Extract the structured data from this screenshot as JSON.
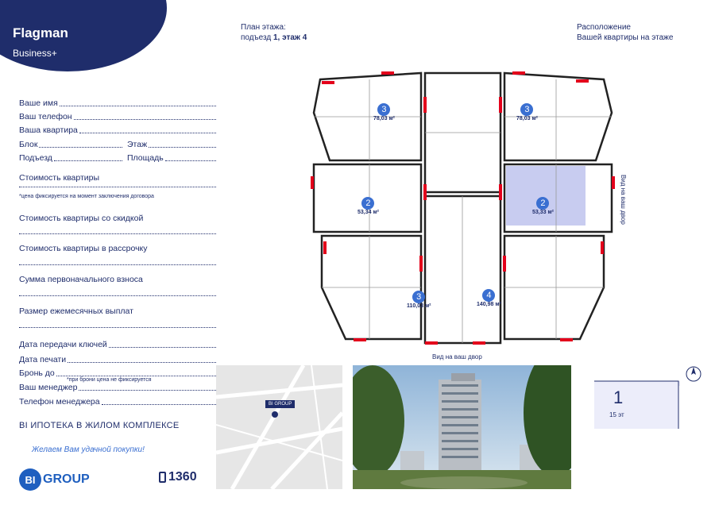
{
  "brand": {
    "title": "Flagman",
    "subtitle": "Business+"
  },
  "form": {
    "name": "Ваше имя",
    "phone": "Ваш телефон",
    "apartment": "Ваша квартира",
    "block": "Блок",
    "floor": "Этаж",
    "entrance": "Подъезд",
    "area": "Площадь",
    "price": "Стоимость квартиры",
    "price_note": "*цена фиксируется на момент заключения договора",
    "price_discount": "Стоимость квартиры со скидкой",
    "price_installment": "Стоимость квартиры в рассрочку",
    "down_payment": "Сумма первоначального взноса",
    "monthly": "Размер ежемесячных выплат",
    "keys_date": "Дата передачи ключей",
    "print_date": "Дата печати",
    "booking": "Бронь до",
    "booking_note": "*при брони цена не фиксируется",
    "manager": "Ваш менеджер",
    "manager_phone": "Телефон менеджера"
  },
  "footer": {
    "mortgage": "BI ИПОТЕКА В ЖИЛОМ КОМПЛЕКСЕ",
    "wish": "Желаем Вам удачной покупки!",
    "logo_mark": "BI",
    "logo_text": "GROUP",
    "short_number": "1360"
  },
  "plan": {
    "heading_line1": "План этажа:",
    "heading_line2_prefix": "подъезд ",
    "heading_line2_value": "1, этаж 4",
    "location_line1": "Расположение",
    "location_line2": "Вашей квартиры на этаже",
    "view_right": "Вид на ваш двор",
    "view_bottom": "Вид на ваш двор",
    "units": [
      {
        "rooms": "3",
        "area": "78,03 м²"
      },
      {
        "rooms": "3",
        "area": "78,03 м²"
      },
      {
        "rooms": "2",
        "area": "53,34 м²"
      },
      {
        "rooms": "2",
        "area": "53,33 м²"
      },
      {
        "rooms": "3",
        "area": "110,03 м²"
      },
      {
        "rooms": "4",
        "area": "140,98 м²"
      }
    ]
  },
  "map": {
    "marker": "BI GROUP"
  },
  "building": {
    "floor": "1",
    "total": "15 эт"
  },
  "colors": {
    "navy": "#1f2d6b",
    "accent_blue": "#3a6fd1",
    "wall_red": "#e3001b",
    "highlight": "#c8ccf0"
  }
}
